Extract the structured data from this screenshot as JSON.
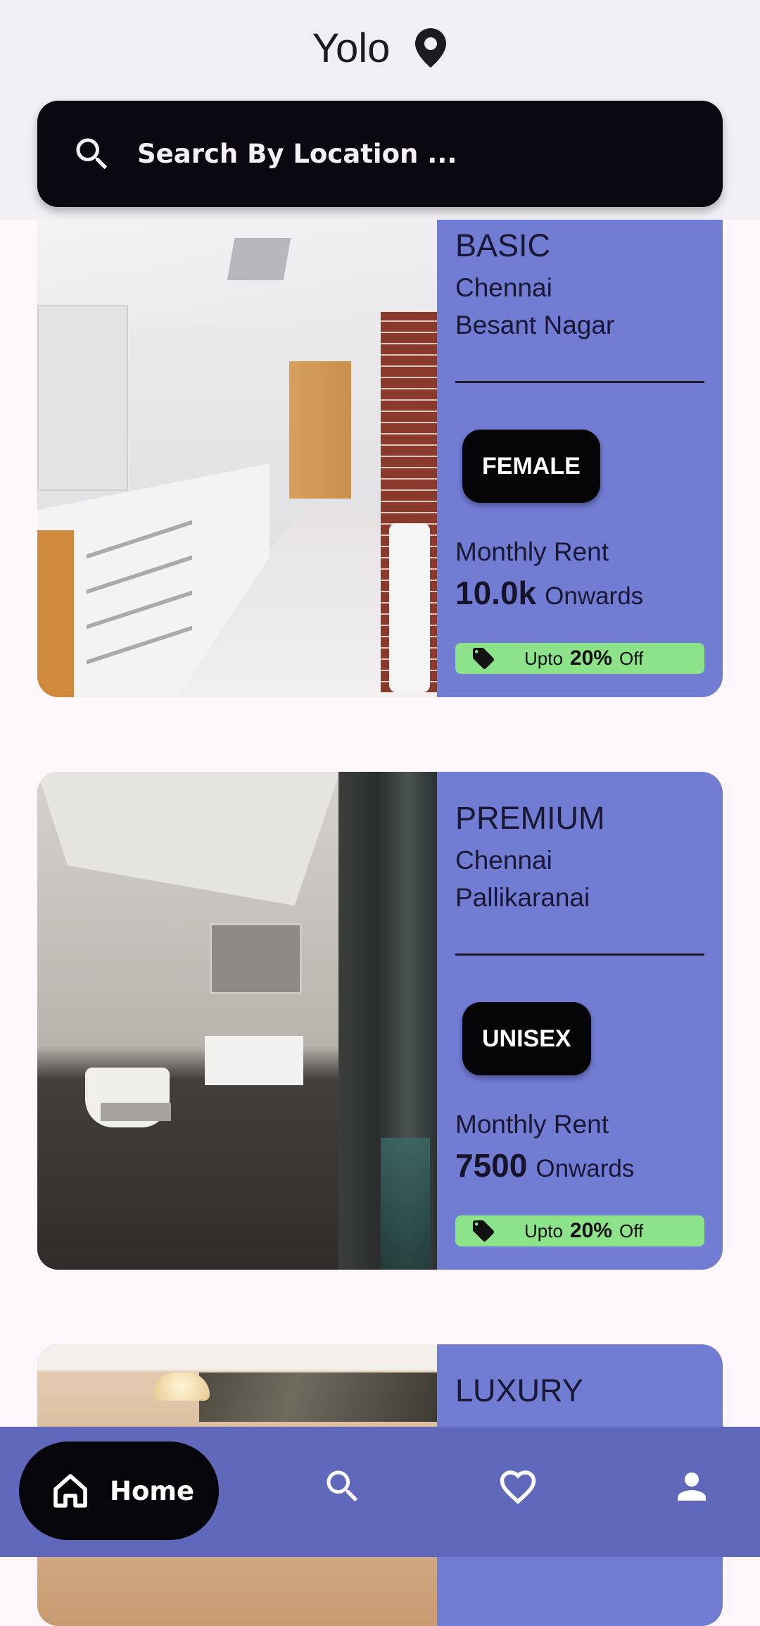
{
  "header": {
    "title": "Yolo",
    "location_icon": "location-pin-icon"
  },
  "search": {
    "placeholder": "Search By Location ...",
    "icon": "search-icon"
  },
  "listings": [
    {
      "tier": "BASIC",
      "city": "Chennai",
      "area": "Besant Nagar",
      "gender": "FEMALE",
      "rent_label": "Monthly Rent",
      "rent_value": "10.0k",
      "rent_suffix": "Onwards",
      "offer_prefix": "Upto",
      "offer_percent": "20%",
      "offer_suffix": "Off"
    },
    {
      "tier": "PREMIUM",
      "city": "Chennai",
      "area": "Pallikaranai",
      "gender": "UNISEX",
      "rent_label": "Monthly Rent",
      "rent_value": "7500",
      "rent_suffix": "Onwards",
      "offer_prefix": "Upto",
      "offer_percent": "20%",
      "offer_suffix": "Off"
    },
    {
      "tier": "LUXURY"
    }
  ],
  "bottom_nav": {
    "home_label": "Home",
    "items": [
      "home-icon",
      "search-icon",
      "heart-icon",
      "profile-icon"
    ]
  },
  "colors": {
    "card_bg": "#717cd3",
    "nav_bg": "#5f68bb",
    "offer_bg": "#8ce38a",
    "search_bg": "#0b0811"
  }
}
